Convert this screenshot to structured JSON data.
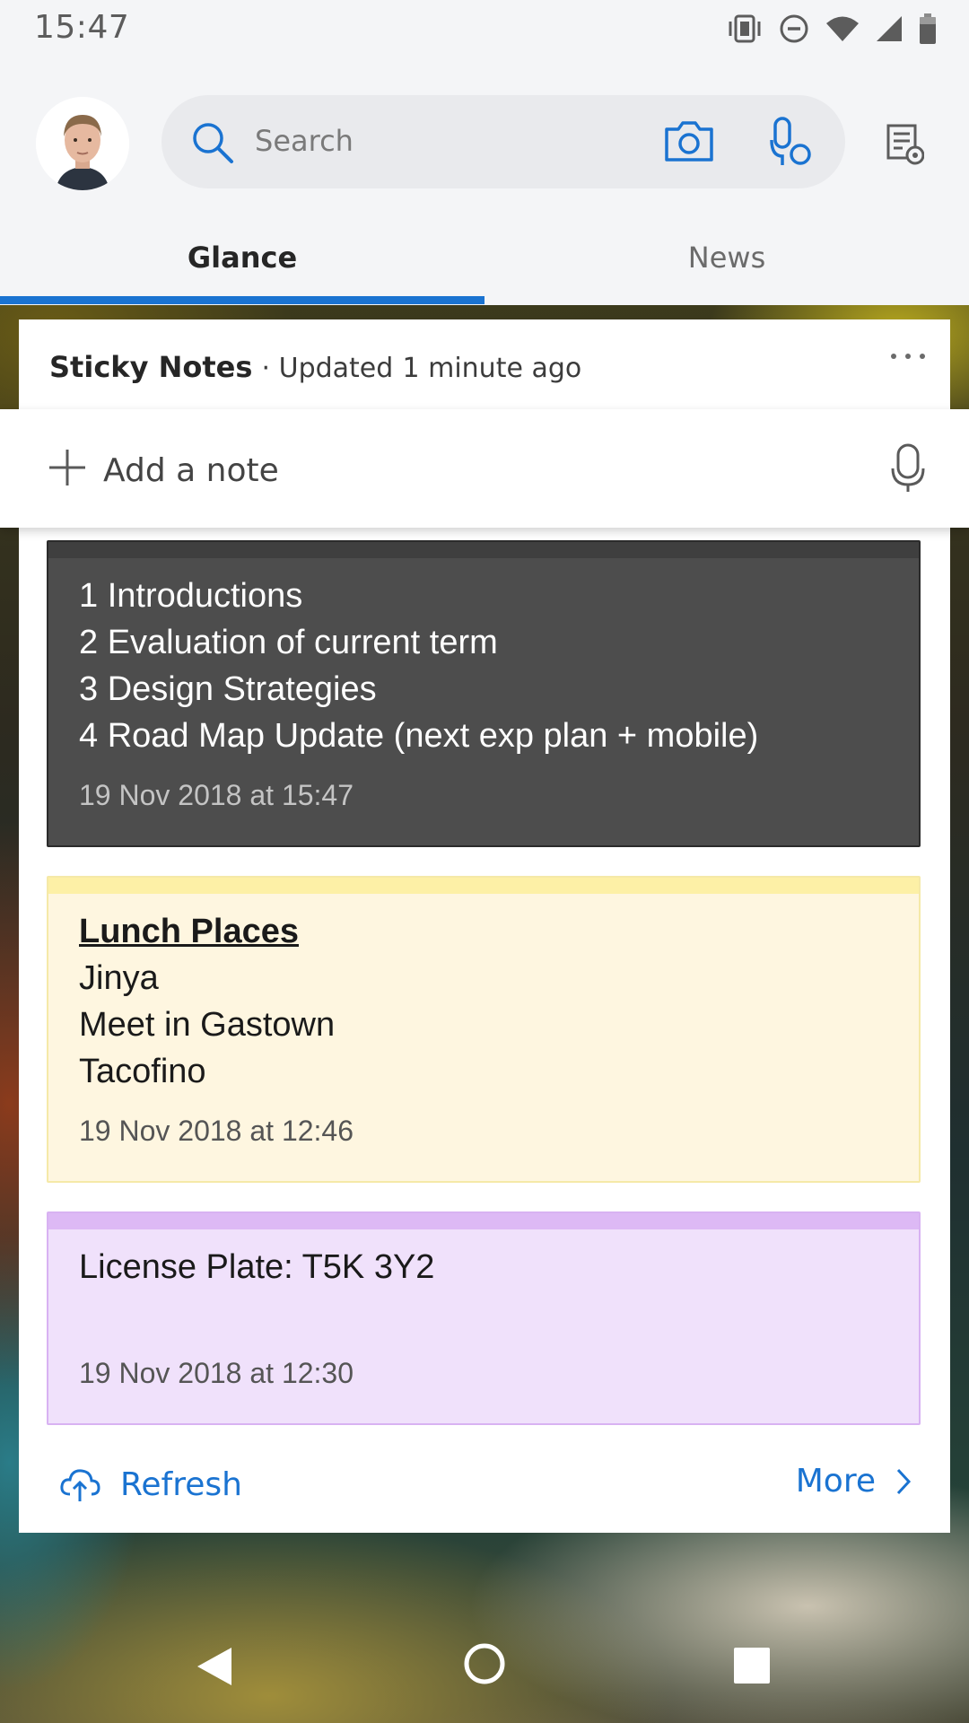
{
  "status_bar": {
    "time": "15:47",
    "icons": [
      "vibrate-icon",
      "do-not-disturb-icon",
      "wifi-icon",
      "signal-icon",
      "battery-icon"
    ]
  },
  "header": {
    "search": {
      "placeholder": "Search"
    },
    "icons": [
      "search-icon",
      "camera-icon",
      "voice-search-icon",
      "feed-settings-icon"
    ]
  },
  "tabs": [
    {
      "label": "Glance",
      "active": true
    },
    {
      "label": "News",
      "active": false
    }
  ],
  "card": {
    "title": "Sticky Notes",
    "updated_prefix": "· Updated",
    "updated_value": "1 minute ago",
    "add_note": {
      "label": "Add a note"
    },
    "notes": [
      {
        "color": "#4d4d4d",
        "lines": [
          "1 Introductions",
          "2 Evaluation of current term",
          "3 Design Strategies",
          "4 Road Map Update (next exp plan + mobile)"
        ],
        "date": "19 Nov 2018 at 15:47"
      },
      {
        "color": "#fef6e0",
        "lines": [
          "Lunch Places",
          "Jinya",
          "Meet in Gastown",
          "Tacofino"
        ],
        "date": "19 Nov 2018 at 12:46"
      },
      {
        "color": "#f0e1fb",
        "lines": [
          "License Plate: T5K 3Y2"
        ],
        "date": "19 Nov 2018 at 12:30"
      }
    ],
    "footer": {
      "refresh_label": "Refresh",
      "more_label": "More"
    }
  },
  "colors": {
    "accent": "#1a73d1",
    "header_bg": "#f4f5f7"
  }
}
